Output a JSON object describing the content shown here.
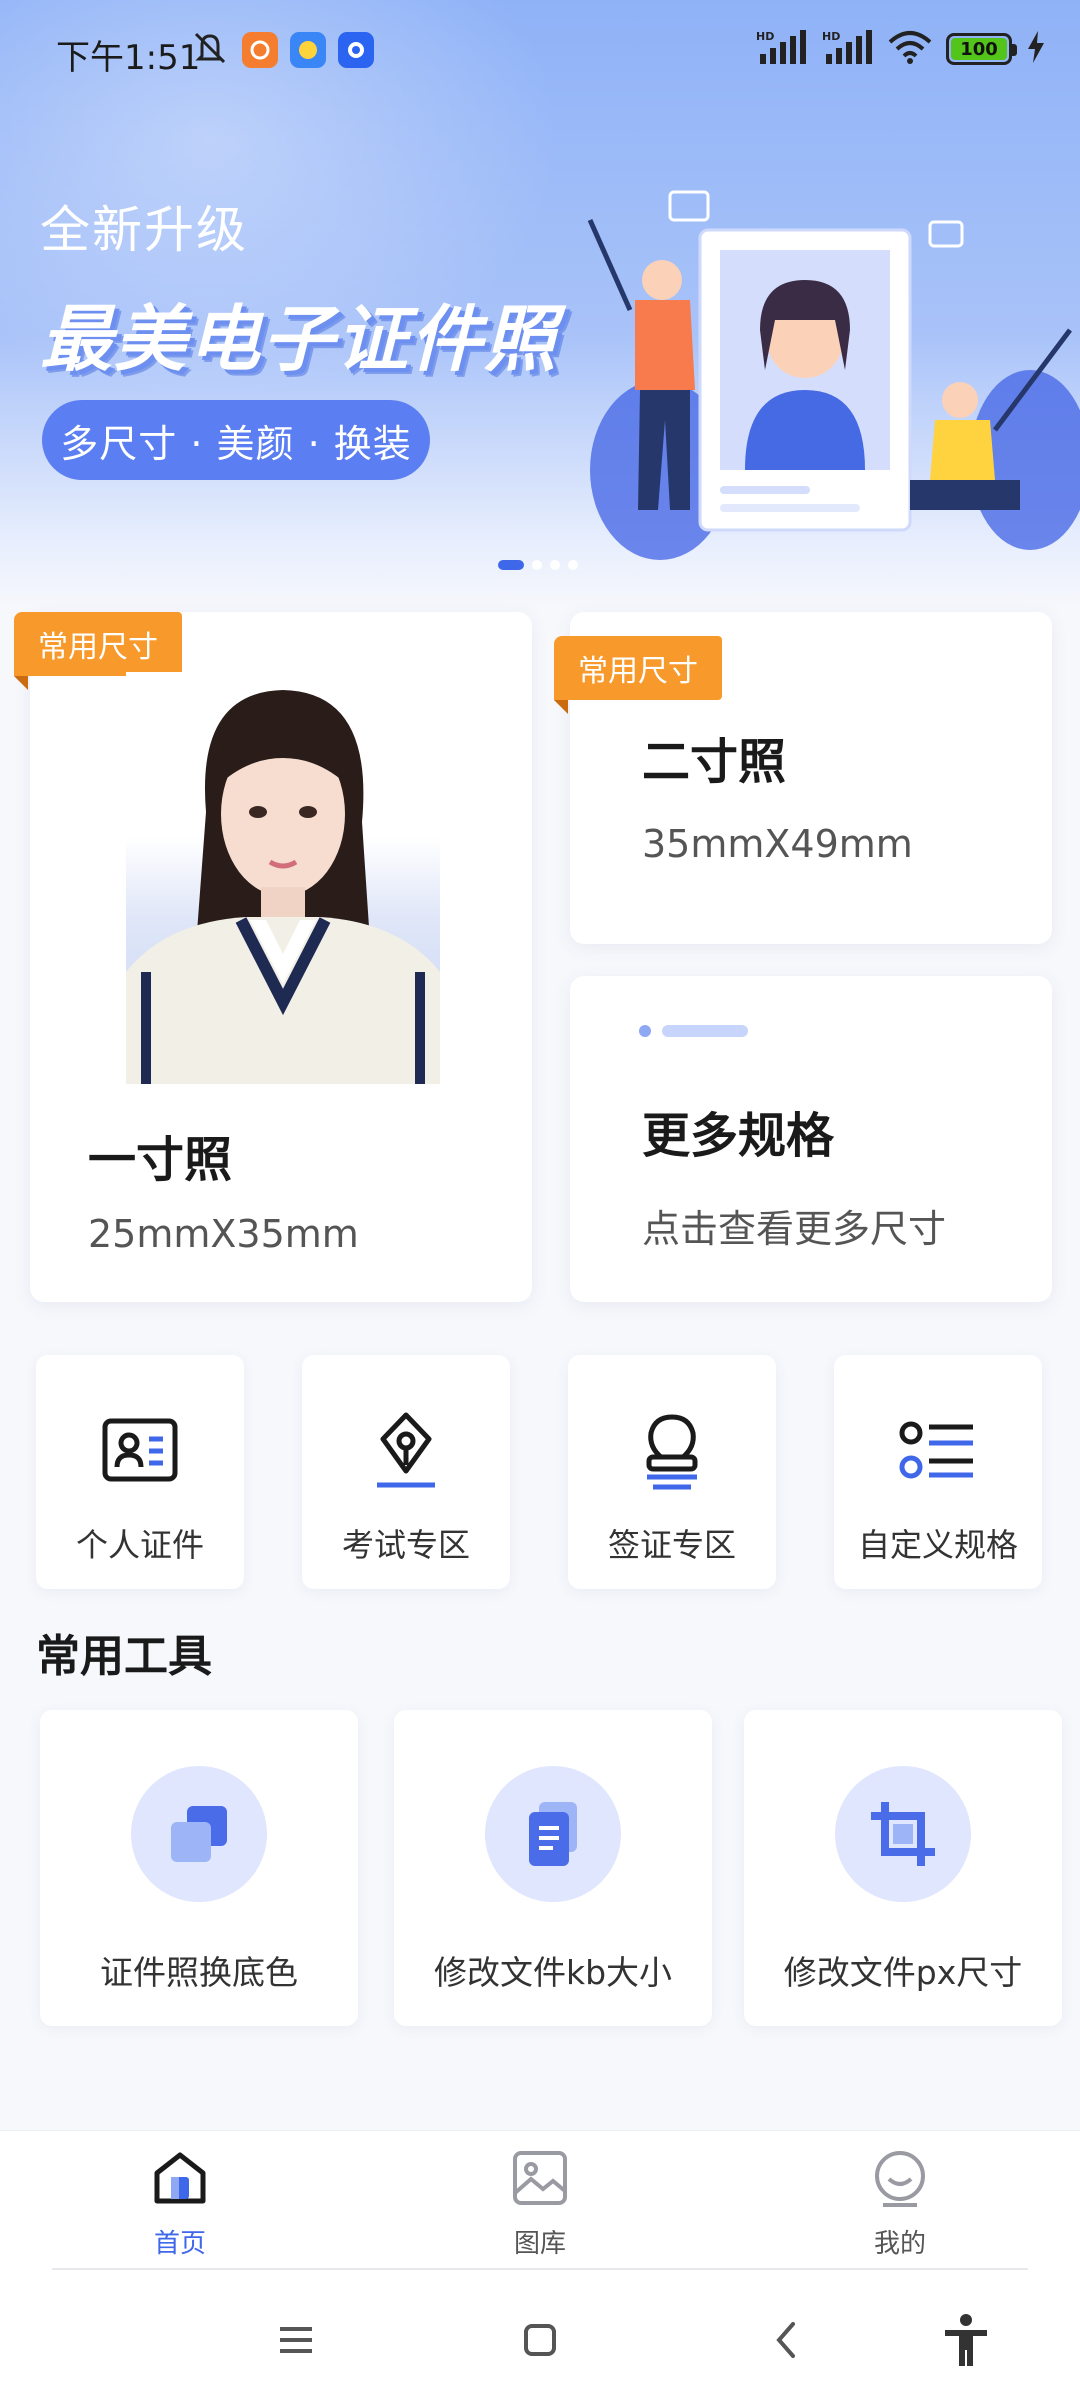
{
  "status": {
    "time": "下午1:51",
    "battery": "100",
    "network": "HD"
  },
  "banner": {
    "subtitle": "全新升级",
    "title": "最美电子证件照",
    "pill": "多尺寸 · 美颜 · 换装",
    "slide_index": 1,
    "slide_count": 4
  },
  "cards": {
    "one_inch": {
      "tag": "常用尺寸",
      "title": "一寸照",
      "size": "25mmX35mm"
    },
    "two_inch": {
      "tag": "常用尺寸",
      "title": "二寸照",
      "size": "35mmX49mm"
    },
    "more": {
      "title": "更多规格",
      "desc": "点击查看更多尺寸"
    }
  },
  "categories": [
    {
      "label": "个人证件",
      "icon": "id-card-icon"
    },
    {
      "label": "考试专区",
      "icon": "pen-nib-icon"
    },
    {
      "label": "签证专区",
      "icon": "stamp-icon"
    },
    {
      "label": "自定义规格",
      "icon": "list-icon"
    }
  ],
  "tools": {
    "title": "常用工具",
    "items": [
      {
        "label": "证件照换底色",
        "icon": "layers-icon"
      },
      {
        "label": "修改文件kb大小",
        "icon": "file-icon"
      },
      {
        "label": "修改文件px尺寸",
        "icon": "crop-icon"
      }
    ]
  },
  "tabbar": {
    "items": [
      {
        "label": "首页",
        "icon": "home-icon",
        "active": true
      },
      {
        "label": "图库",
        "icon": "gallery-icon",
        "active": false
      },
      {
        "label": "我的",
        "icon": "profile-icon",
        "active": false
      }
    ]
  },
  "colors": {
    "accent": "#3f67ea",
    "tag": "#f7992b",
    "icon_bg": "#dfe6fd"
  }
}
